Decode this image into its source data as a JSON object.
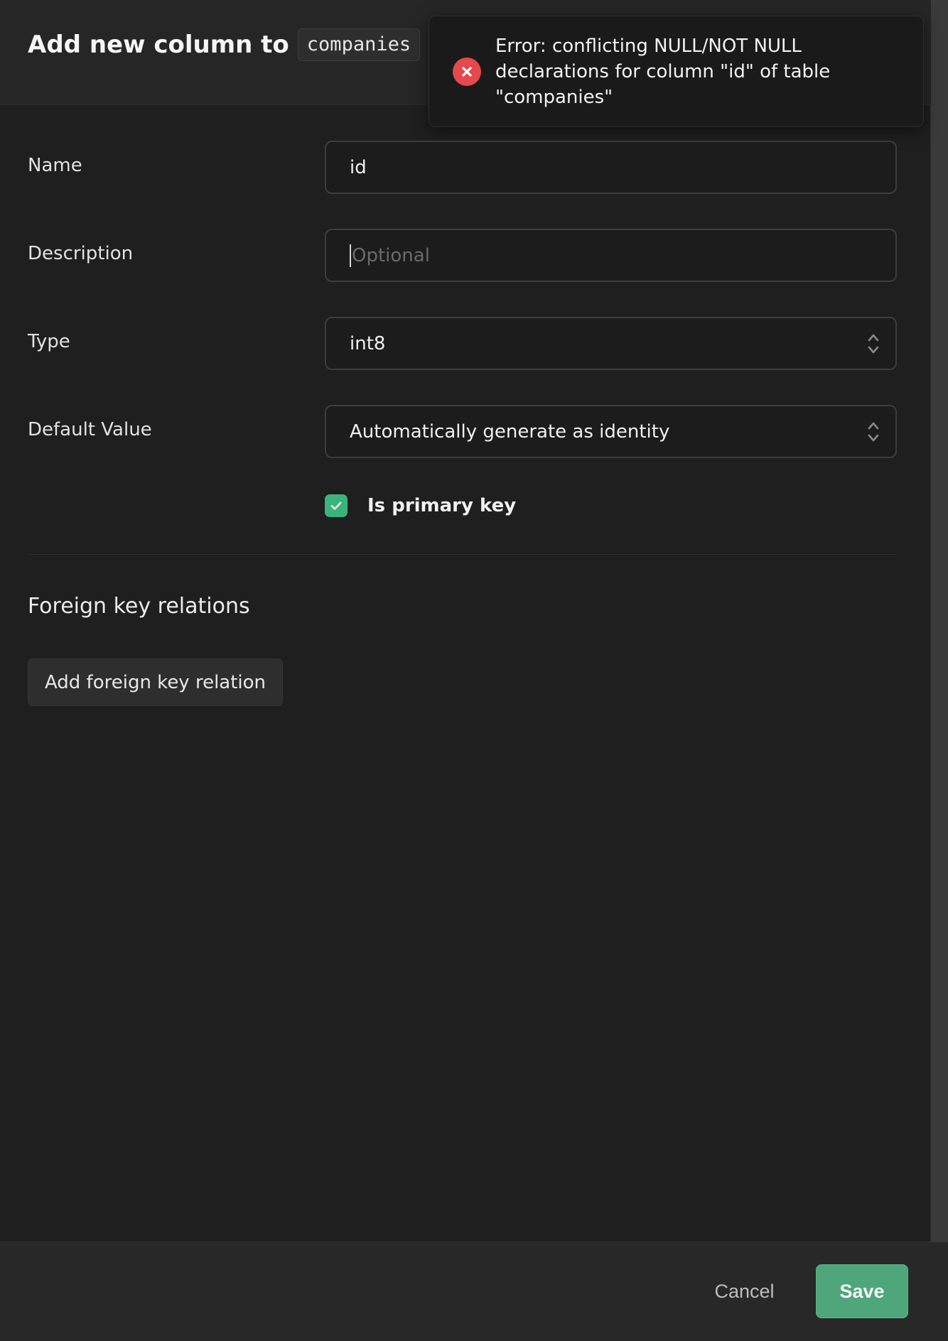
{
  "header": {
    "title": "Add new column to",
    "table_name": "companies"
  },
  "form": {
    "name": {
      "label": "Name",
      "value": "id"
    },
    "description": {
      "label": "Description",
      "placeholder": "Optional"
    },
    "type": {
      "label": "Type",
      "value": "int8"
    },
    "default_value": {
      "label": "Default Value",
      "value": "Automatically generate as identity"
    },
    "primary_key": {
      "label": "Is primary key",
      "checked": true
    }
  },
  "foreign_keys": {
    "title": "Foreign key relations",
    "add_label": "Add foreign key relation"
  },
  "footer": {
    "cancel_label": "Cancel",
    "save_label": "Save"
  },
  "toast": {
    "message": "Error: conflicting NULL/NOT NULL declarations for column \"id\" of table \"companies\""
  },
  "colors": {
    "accent": "#3ecf8e",
    "save": "#4ea67a",
    "error": "#e5484d"
  },
  "icons": {
    "checkbox": "check-icon",
    "select": "chevrons-up-down-icon",
    "error": "x-circle-icon"
  }
}
